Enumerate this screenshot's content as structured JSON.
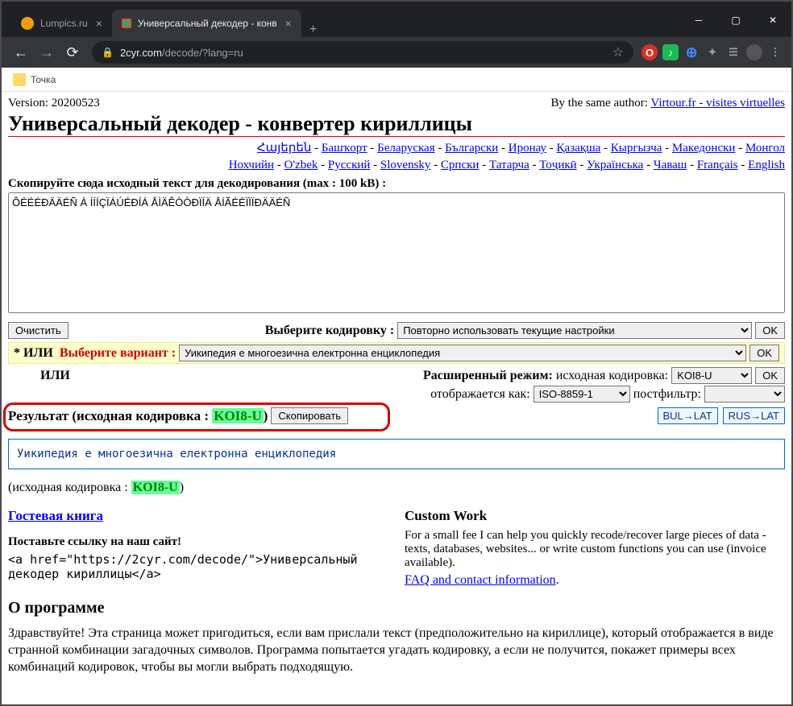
{
  "tabs": [
    {
      "title": "Lumpics.ru",
      "favicon": "#f39c12"
    },
    {
      "title": "Универсальный декодер - конв",
      "favicon": "#e74c3c"
    }
  ],
  "url_host": "2cyr.com",
  "url_path": "/decode/?lang=ru",
  "bookmark": "Точка",
  "version": "Version: 20200523",
  "by_author": "By the same author: ",
  "virtour": "Virtour.fr - visites virtuelles",
  "heading": "Универсальный декодер - конвертер кириллицы",
  "langs1": [
    "Հայերեն",
    "Башҡорт",
    "Беларуская",
    "Български",
    "Иронау",
    "Қазақша",
    "Кыргызча",
    "Македонски",
    "Монгол"
  ],
  "langs2": [
    "Нохчийн",
    "O'zbek",
    "Русский",
    "Slovensky",
    "Српски",
    "Татарча",
    "Тоҷикӣ",
    "Українська",
    "Чаваш",
    "Français",
    "English"
  ],
  "src_prompt": "Скопируйте сюда исходный текст для декодирования (max : 100 kB) :",
  "src_text": "ÔÉÉÉÐÄÄÉÑ À ÍÍÍÇÏÁÚÉÐÍÁ ÅÌÄÊÒÒÐÏÍÄ ÅÍÃÉÉÏÌÏÐÄÄÉÑ",
  "btn_clear": "Очистить",
  "sel_enc_label": "Выберите кодировку :",
  "sel_enc_opt": "Повторно использовать текущие настройки",
  "btn_ok": "OK",
  "or_star": "*",
  "or_label": "ИЛИ",
  "variant_label": "Выберите вариант :",
  "variant_opt": "Уикипедия е многоезична електронна енциклопедия",
  "ext_label": "Расширенный режим:",
  "ext_src": "исходная кодировка:",
  "ext_src_opt": "KOI8-U",
  "ext_disp": "отображается как:",
  "ext_disp_opt": "ISO-8859-1",
  "ext_post": "постфильтр:",
  "result_label": "Результат (исходная кодировка : ",
  "result_enc": "KOI8-U",
  "result_close": ")",
  "btn_copy": "Скопировать",
  "bul_lat": "BUL→LAT",
  "rus_lat": "RUS→LAT",
  "result_text": "Уикипедия е многоезична електронна енциклопедия",
  "src_note_a": "(исходная кодировка : ",
  "src_note_b": "KOI8-U",
  "src_note_c": ")",
  "guestbook": "Гостевая книга",
  "link_prompt": "Поставьте ссылку на наш сайт!",
  "link_code": "<a href=\"https://2cyr.com/decode/\">Универсальный декодер кириллицы</a>",
  "custom_h": "Custom Work",
  "custom_p": "For a small fee I can help you quickly recode/recover large pieces of data - texts, databases, websites... or write custom functions you can use (invoice available).",
  "faq": "FAQ and contact information",
  "about_h": "О программе",
  "about_p": "Здравствуйте! Эта страница может пригодиться, если вам прислали текст (предположительно на кириллице), который отображается в виде странной комбинации загадочных символов. Программа попытается угадать кодировку, а если не получится, покажет примеры всех комбинаций кодировок, чтобы вы могли выбрать подходящую."
}
